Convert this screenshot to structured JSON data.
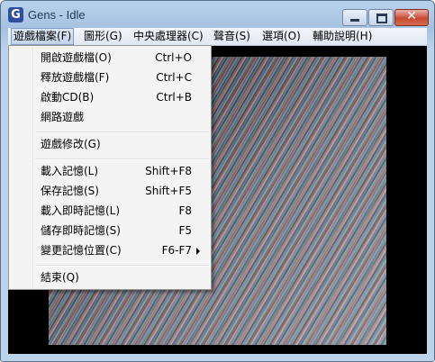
{
  "window": {
    "title": "Gens - Idle",
    "app_icon_glyph": "G",
    "controls": {
      "minimize": "minimize-icon",
      "maximize": "maximize-icon",
      "close": "close-icon",
      "close_glyph": "✕"
    }
  },
  "menubar": {
    "items": [
      {
        "label": "遊戲檔案(F)",
        "active": true
      },
      {
        "label": "圖形(G)"
      },
      {
        "label": "中央處理器(C)"
      },
      {
        "label": "聲音(S)"
      },
      {
        "label": "選項(O)"
      },
      {
        "label": "輔助說明(H)"
      }
    ]
  },
  "file_menu": {
    "items": [
      {
        "label": "開啟遊戲檔(O)",
        "shortcut": "Ctrl+O"
      },
      {
        "label": "釋放遊戲檔(F)",
        "shortcut": "Ctrl+C"
      },
      {
        "label": "啟動CD(B)",
        "shortcut": "Ctrl+B"
      },
      {
        "label": "網路遊戲",
        "shortcut": ""
      },
      {
        "label": "遊戲修改(G)",
        "shortcut": ""
      },
      {
        "label": "載入記憶(L)",
        "shortcut": "Shift+F8"
      },
      {
        "label": "保存記憶(S)",
        "shortcut": "Shift+F5"
      },
      {
        "label": "載入即時記憶(L)",
        "shortcut": "F8"
      },
      {
        "label": "儲存即時記憶(S)",
        "shortcut": "F5"
      },
      {
        "label": "變更記憶位置(C)",
        "shortcut": "F6-F7",
        "submenu": true
      },
      {
        "label": "結束(Q)",
        "shortcut": ""
      }
    ]
  },
  "colors": {
    "menu_bg": "#f4f4f4",
    "client_bg": "#000000",
    "titlebar": "#b9d1ea"
  }
}
